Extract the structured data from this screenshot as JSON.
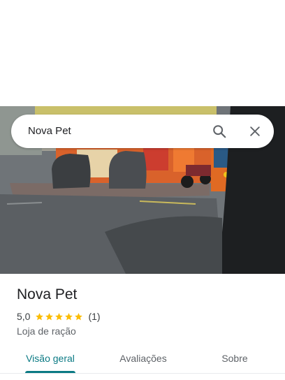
{
  "search": {
    "query": "Nova Pet",
    "search_icon": "search-icon",
    "close_icon": "close-icon"
  },
  "place": {
    "name": "Nova Pet",
    "rating": "5,0",
    "stars_filled": 5,
    "review_count": "(1)",
    "category": "Loja de ração"
  },
  "tabs": [
    {
      "label": "Visão geral",
      "selected": true
    },
    {
      "label": "Avaliações",
      "selected": false
    },
    {
      "label": "Sobre",
      "selected": false
    }
  ],
  "colors": {
    "accent": "#0b7a84",
    "star": "#fbbc04",
    "text": "#202124",
    "secondary_text": "#5f6368"
  }
}
